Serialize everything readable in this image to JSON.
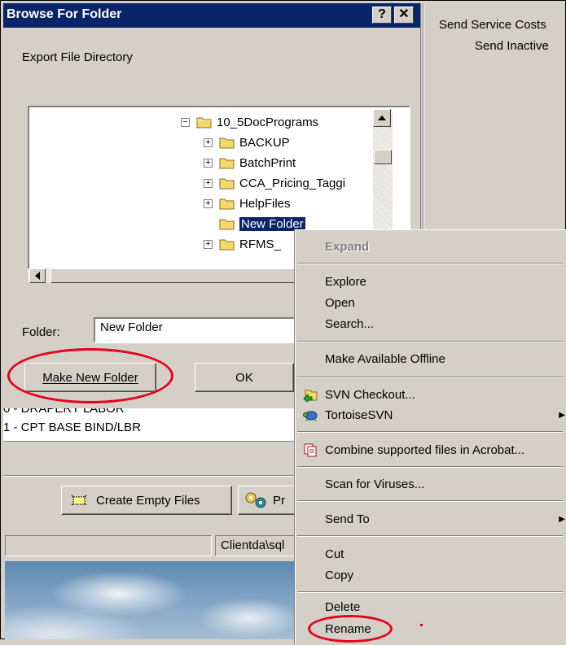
{
  "dialog": {
    "title": "Browse For Folder",
    "help_label": "?",
    "close_label": "✕",
    "description": "Export File Directory",
    "folder_label": "Folder:",
    "folder_value": "New Folder",
    "make_new_folder_label": "Make New Folder",
    "ok_label": "OK"
  },
  "tree": {
    "items": [
      {
        "label": "10_5DocPrograms",
        "expander": "−"
      },
      {
        "label": "BACKUP",
        "expander": "+"
      },
      {
        "label": "BatchPrint",
        "expander": "+"
      },
      {
        "label": "CCA_Pricing_Taggi",
        "expander": "+"
      },
      {
        "label": "HelpFiles",
        "expander": "+"
      },
      {
        "label": "New Folder",
        "expander": ""
      },
      {
        "label": "RFMS_",
        "expander": "+"
      }
    ]
  },
  "background": {
    "send_service_costs": "Send Service Costs",
    "send_inactive": "Send Inactive",
    "list_row_1": "0 - DRAPERY LABOR",
    "list_row_2": "1 - CPT BASE BIND/LBR",
    "create_empty_files_label": "Create Empty Files",
    "process_label": "Pr",
    "status_path": "Clientda\\sql"
  },
  "context_menu": {
    "items": [
      {
        "label": "Expand",
        "disabled": true
      },
      {
        "label": "Explore"
      },
      {
        "label": "Open"
      },
      {
        "label": "Search..."
      },
      {
        "label": "Make Available Offline"
      },
      {
        "label": "SVN Checkout..."
      },
      {
        "label": "TortoiseSVN",
        "submenu": true
      },
      {
        "label": "Combine supported files in Acrobat..."
      },
      {
        "label": "Scan for Viruses..."
      },
      {
        "label": "Send To",
        "submenu": true
      },
      {
        "label": "Cut"
      },
      {
        "label": "Copy"
      },
      {
        "label": "Delete"
      },
      {
        "label": "Rename"
      }
    ]
  },
  "colors": {
    "annotation": "#e8001c",
    "titlebar": "#0a246a",
    "face": "#d4d0c8"
  }
}
